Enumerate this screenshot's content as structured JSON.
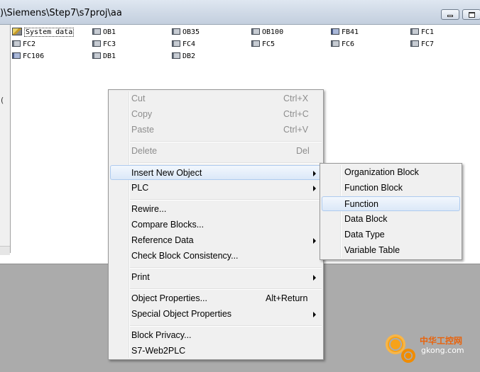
{
  "window": {
    "title": ")\\Siemens\\Step7\\s7proj\\aa"
  },
  "blocks": [
    {
      "label": "System data",
      "kind": "system"
    },
    {
      "label": "OB1",
      "kind": "block"
    },
    {
      "label": "OB35",
      "kind": "block"
    },
    {
      "label": "OB100",
      "kind": "block"
    },
    {
      "label": "FB41",
      "kind": "fb"
    },
    {
      "label": "FC1",
      "kind": "block"
    },
    {
      "label": "FC2",
      "kind": "block"
    },
    {
      "label": "FC3",
      "kind": "block"
    },
    {
      "label": "FC4",
      "kind": "block"
    },
    {
      "label": "FC5",
      "kind": "block"
    },
    {
      "label": "FC6",
      "kind": "block"
    },
    {
      "label": "FC7",
      "kind": "block"
    },
    {
      "label": "FC106",
      "kind": "fb"
    },
    {
      "label": "DB1",
      "kind": "block"
    },
    {
      "label": "DB2",
      "kind": "block"
    }
  ],
  "left_strip_text": "(",
  "context_menu": {
    "items": [
      {
        "label": "Cut",
        "shortcut": "Ctrl+X",
        "disabled": true
      },
      {
        "label": "Copy",
        "shortcut": "Ctrl+C",
        "disabled": true
      },
      {
        "label": "Paste",
        "shortcut": "Ctrl+V",
        "disabled": true
      },
      {
        "label": "Delete",
        "shortcut": "Del",
        "disabled": true
      },
      {
        "label": "Insert New Object",
        "submenu": true,
        "highlighted": true
      },
      {
        "label": "PLC",
        "submenu": true
      },
      {
        "label": "Rewire..."
      },
      {
        "label": "Compare Blocks..."
      },
      {
        "label": "Reference Data",
        "submenu": true
      },
      {
        "label": "Check Block Consistency..."
      },
      {
        "label": "Print",
        "submenu": true
      },
      {
        "label": "Object Properties...",
        "shortcut": "Alt+Return"
      },
      {
        "label": "Special Object Properties",
        "submenu": true
      },
      {
        "label": "Block Privacy..."
      },
      {
        "label": "S7-Web2PLC"
      }
    ]
  },
  "submenu": {
    "items": [
      {
        "label": "Organization Block"
      },
      {
        "label": "Function Block"
      },
      {
        "label": "Function",
        "highlighted": true
      },
      {
        "label": "Data Block"
      },
      {
        "label": "Data Type"
      },
      {
        "label": "Variable Table"
      }
    ]
  },
  "watermark": {
    "chinese": "中华工控网",
    "url": "gkong.com"
  }
}
